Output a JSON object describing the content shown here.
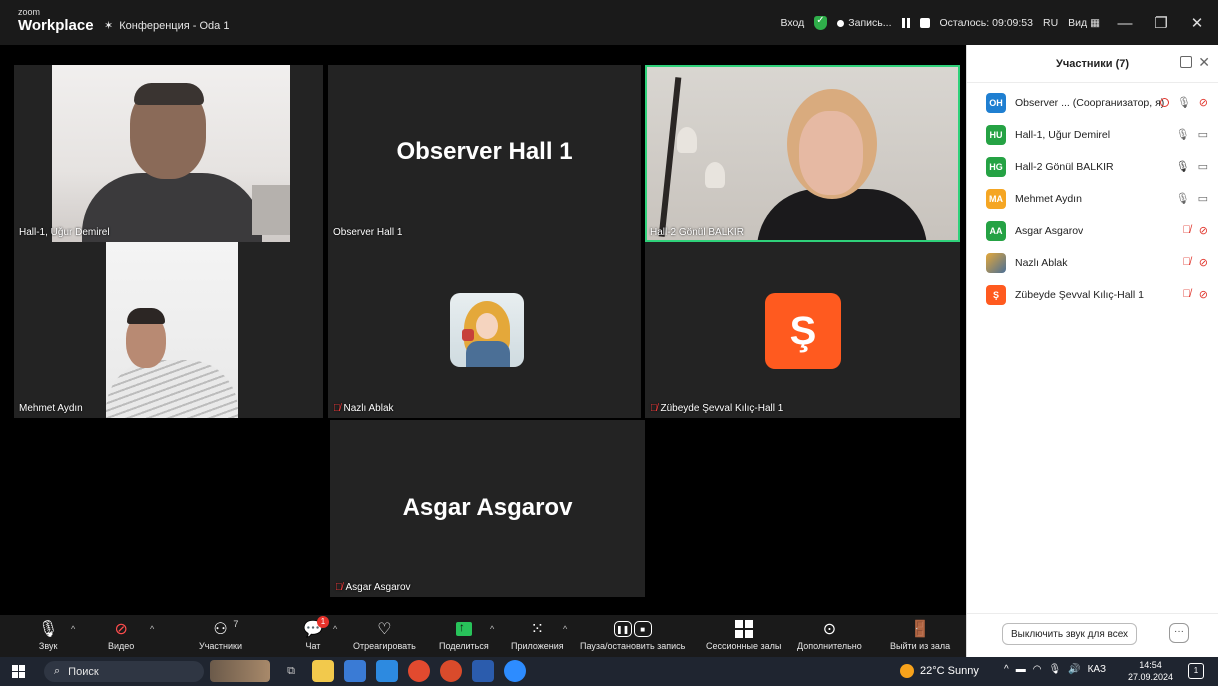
{
  "app": {
    "brand_top": "zoom",
    "brand_bottom": "Workplace",
    "meeting_title": "Конференция - Oda 1"
  },
  "topbar": {
    "signin": "Вход",
    "recording": "Запись...",
    "remaining": "Осталось: 09:09:53",
    "language": "RU",
    "view": "Вид"
  },
  "tiles": [
    {
      "name": "Hall-1, Uğur Demirel",
      "big": "",
      "muted": false
    },
    {
      "name": "Observer Hall 1",
      "big": "Observer Hall 1",
      "muted": false
    },
    {
      "name": "Hall-2 Gönül BALKIR",
      "big": "",
      "muted": false,
      "active": true
    },
    {
      "name": "Mehmet Aydın",
      "big": "",
      "muted": false
    },
    {
      "name": "Nazlı Ablak",
      "big": "",
      "muted": true
    },
    {
      "name": "Zübeyde Şevval Kılıç-Hall 1",
      "big": "",
      "muted": true,
      "avatar_letter": "Ş"
    },
    {
      "name": "Asgar Asgarov",
      "big": "Asgar Asgarov",
      "muted": true
    }
  ],
  "panel": {
    "title": "Участники (7)",
    "participants": [
      {
        "initials": "OH",
        "name": "Observer ... (Соорганизатор, я)",
        "color": "#1f7fd1",
        "mic": "on",
        "video": "off",
        "recording": true
      },
      {
        "initials": "HU",
        "name": "Hall-1, Uğur Demirel",
        "color": "#25a244",
        "mic": "on",
        "video": "on"
      },
      {
        "initials": "HG",
        "name": "Hall-2 Gönül BALKIR",
        "color": "#25a244",
        "mic": "speaking",
        "video": "on"
      },
      {
        "initials": "MA",
        "name": "Mehmet Aydın",
        "color": "#f5a623",
        "mic": "on",
        "video": "on"
      },
      {
        "initials": "AA",
        "name": "Asgar Asgarov",
        "color": "#25a244",
        "mic": "off",
        "video": "off"
      },
      {
        "initials": "",
        "name": "Nazlı Ablak",
        "color": "image",
        "mic": "off",
        "video": "off"
      },
      {
        "initials": "Ş",
        "name": "Zübeyde Şevval Kılıç-Hall 1",
        "color": "#ff5a1f",
        "mic": "off",
        "video": "off"
      }
    ],
    "mute_all": "Выключить звук для всех",
    "more": "···"
  },
  "toolbar": {
    "audio": "Звук",
    "video": "Видео",
    "participants": "Участники",
    "participants_count": "7",
    "chat": "Чат",
    "chat_badge": "1",
    "react": "Отреагировать",
    "share": "Поделиться",
    "apps": "Приложения",
    "pause_recording": "Пауза/остановить запись",
    "breakout": "Сессионные залы",
    "more": "Дополнительно",
    "leave": "Выйти из зала"
  },
  "taskbar": {
    "search": "Поиск",
    "weather": "22°C Sunny",
    "keyboard": "КАЗ",
    "time": "14:54",
    "date": "27.09.2024",
    "notifications": "1"
  }
}
